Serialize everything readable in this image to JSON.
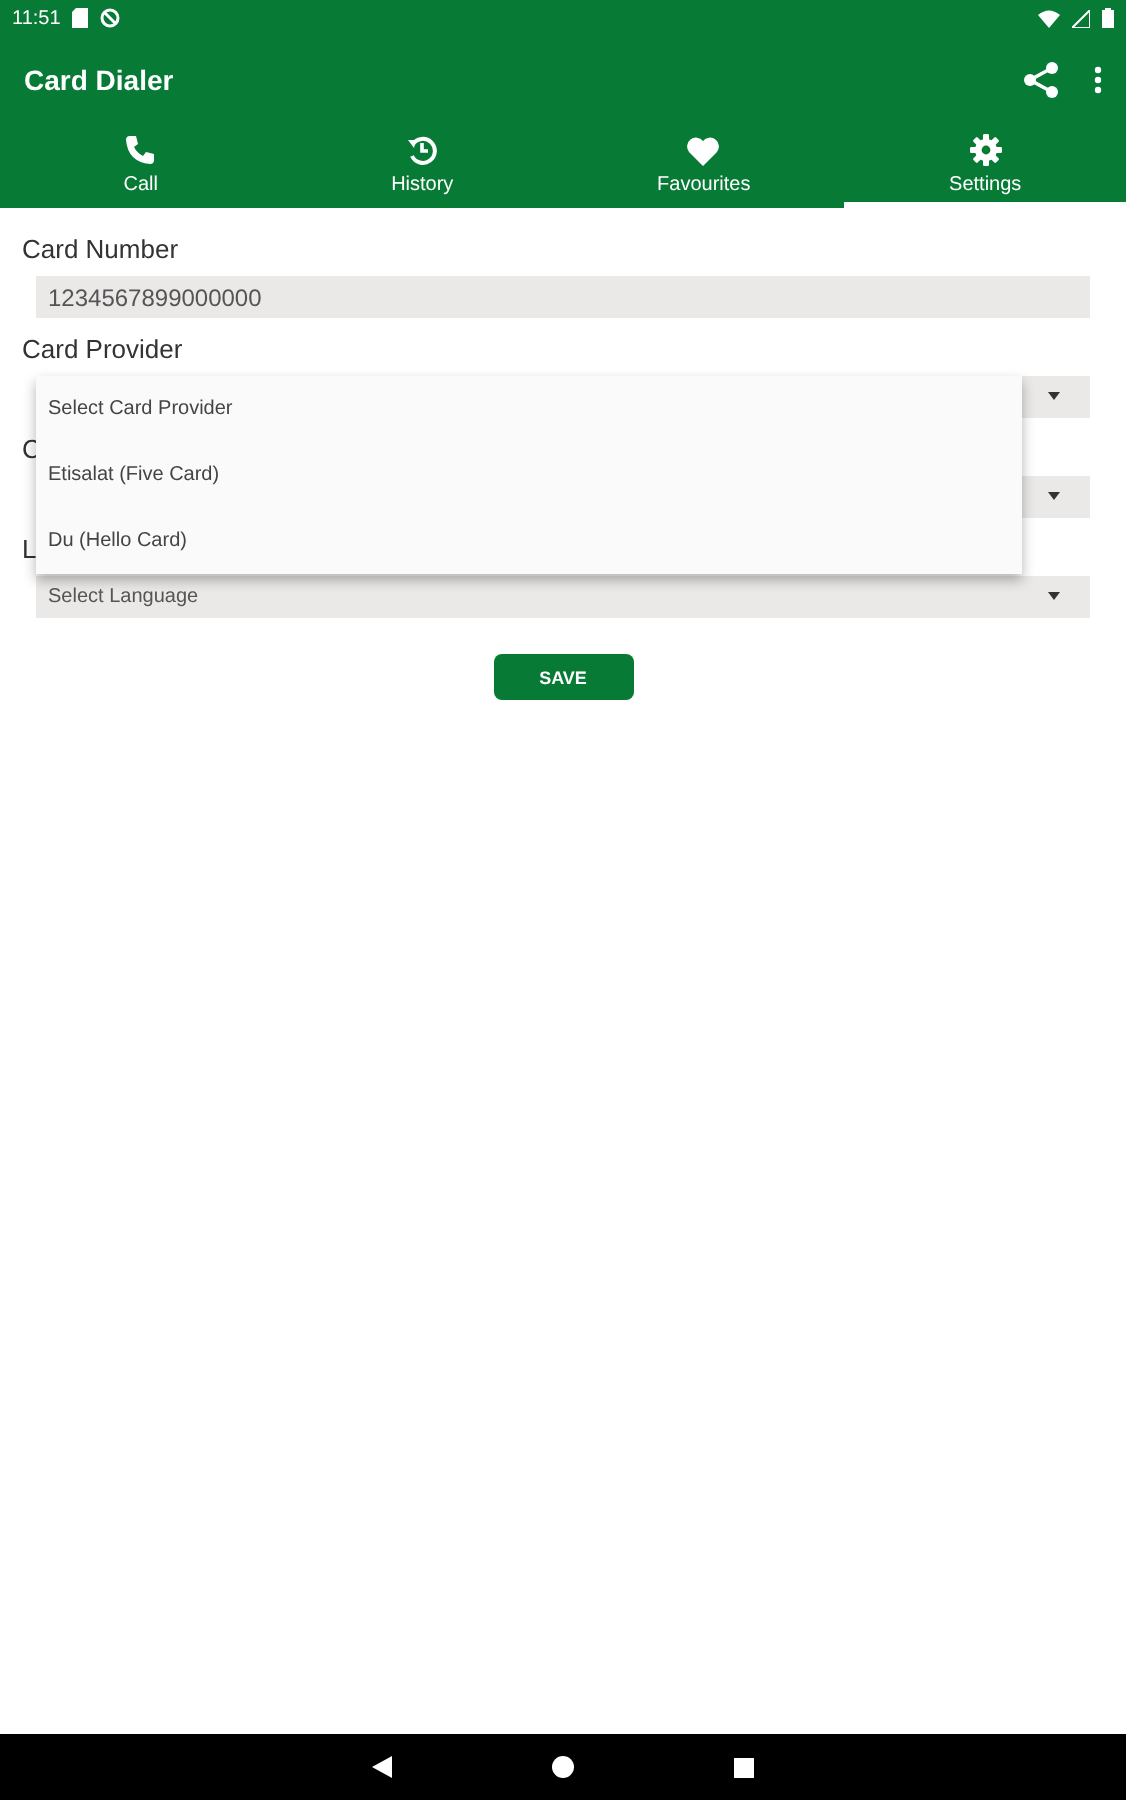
{
  "status_bar": {
    "time": "11:51"
  },
  "app_bar": {
    "title": "Card Dialer"
  },
  "tabs": [
    {
      "label": "Call",
      "kind": "call",
      "selected": false
    },
    {
      "label": "History",
      "kind": "history",
      "selected": false
    },
    {
      "label": "Favourites",
      "kind": "favourites",
      "selected": false
    },
    {
      "label": "Settings",
      "kind": "settings",
      "selected": true
    }
  ],
  "form": [
    {
      "label": "Card Number",
      "kind": "text",
      "value": "1234567899000000"
    },
    {
      "label": "Card Provider",
      "kind": "dropdown"
    },
    {
      "label": "C",
      "kind": "dropdown"
    },
    {
      "label": "L",
      "kind": "dropdown",
      "value": "Select Language"
    }
  ],
  "dropdown_menu": {
    "items": [
      "Select Card Provider",
      "Etisalat (Five Card)",
      "Du (Hello Card)"
    ]
  },
  "save_button": {
    "label": "SAVE"
  }
}
